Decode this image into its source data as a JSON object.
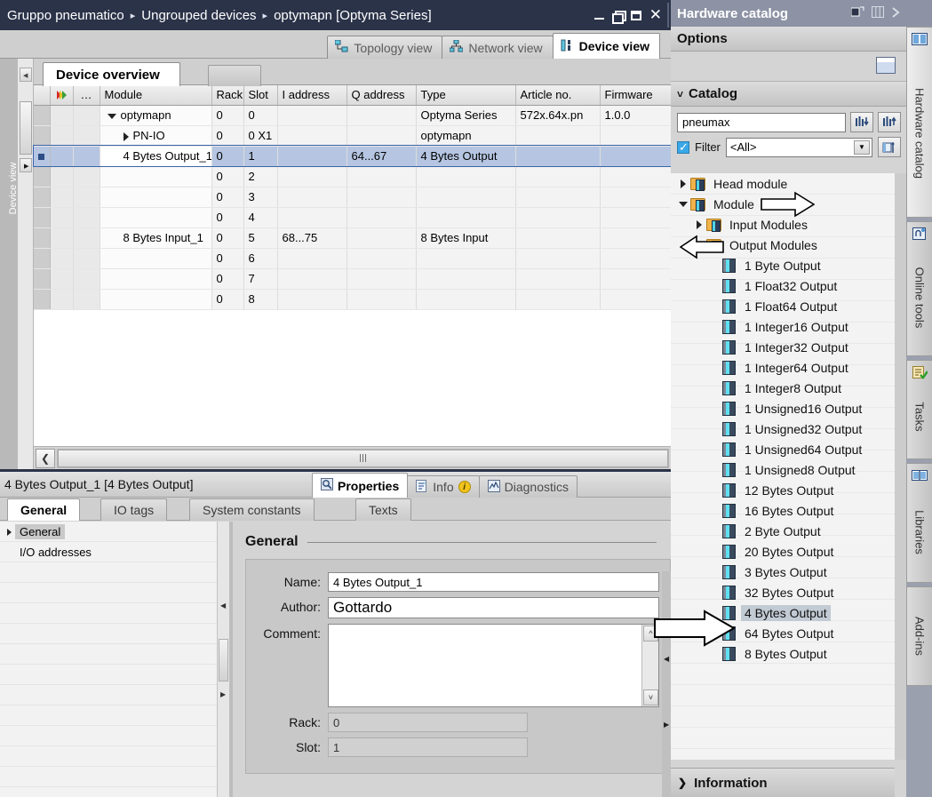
{
  "titlebar": {
    "breadcrumb": [
      "Gruppo pneumatico",
      "Ungrouped devices",
      "optymapn [Optyma Series]"
    ],
    "separator": "▸",
    "buttons": {
      "minimize": "minimize-icon",
      "restore": "restore-icon",
      "maximize": "maximize-icon",
      "close": "✕"
    }
  },
  "view_tabs": [
    {
      "label": "Topology view",
      "active": false
    },
    {
      "label": "Network view",
      "active": false
    },
    {
      "label": "Device view",
      "active": true
    }
  ],
  "left_rail": {
    "label": "Device view"
  },
  "device_overview": {
    "tab_label": "Device overview",
    "columns": [
      "",
      "…",
      "Module",
      "Rack",
      "Slot",
      "I address",
      "Q address",
      "Type",
      "Article no.",
      "Firmware"
    ],
    "rows": [
      {
        "module": "optymapn",
        "indent": 1,
        "twisty": "down",
        "rack": "0",
        "slot": "0",
        "i_address": "",
        "q_address": "",
        "type": "Optyma Series",
        "article": "572x.64x.pn",
        "firmware": "1.0.0",
        "selected": false
      },
      {
        "module": "PN-IO",
        "indent": 2,
        "twisty": "right",
        "rack": "0",
        "slot": "0 X1",
        "i_address": "",
        "q_address": "",
        "type": "optymapn",
        "article": "",
        "firmware": "",
        "selected": false
      },
      {
        "module": "4 Bytes Output_1",
        "indent": 2,
        "twisty": "none",
        "rack": "0",
        "slot": "1",
        "i_address": "",
        "q_address": "64...67",
        "type": "4 Bytes Output",
        "article": "",
        "firmware": "",
        "selected": true
      },
      {
        "module": "",
        "indent": 0,
        "twisty": "none",
        "rack": "0",
        "slot": "2",
        "i_address": "",
        "q_address": "",
        "type": "",
        "article": "",
        "firmware": "",
        "selected": false
      },
      {
        "module": "",
        "indent": 0,
        "twisty": "none",
        "rack": "0",
        "slot": "3",
        "i_address": "",
        "q_address": "",
        "type": "",
        "article": "",
        "firmware": "",
        "selected": false
      },
      {
        "module": "",
        "indent": 0,
        "twisty": "none",
        "rack": "0",
        "slot": "4",
        "i_address": "",
        "q_address": "",
        "type": "",
        "article": "",
        "firmware": "",
        "selected": false
      },
      {
        "module": "8 Bytes Input_1",
        "indent": 2,
        "twisty": "none",
        "rack": "0",
        "slot": "5",
        "i_address": "68...75",
        "q_address": "",
        "type": "8 Bytes Input",
        "article": "",
        "firmware": "",
        "selected": false
      },
      {
        "module": "",
        "indent": 0,
        "twisty": "none",
        "rack": "0",
        "slot": "6",
        "i_address": "",
        "q_address": "",
        "type": "",
        "article": "",
        "firmware": "",
        "selected": false
      },
      {
        "module": "",
        "indent": 0,
        "twisty": "none",
        "rack": "0",
        "slot": "7",
        "i_address": "",
        "q_address": "",
        "type": "",
        "article": "",
        "firmware": "",
        "selected": false
      },
      {
        "module": "",
        "indent": 0,
        "twisty": "none",
        "rack": "0",
        "slot": "8",
        "i_address": "",
        "q_address": "",
        "type": "",
        "article": "",
        "firmware": "",
        "selected": false
      }
    ]
  },
  "properties": {
    "header_title": "4 Bytes Output_1 [4 Bytes Output]",
    "tabs": [
      {
        "label": "Properties",
        "active": true,
        "icon": "properties-icon"
      },
      {
        "label": "Info",
        "active": false,
        "icon": "info-icon",
        "badge": "i"
      },
      {
        "label": "Diagnostics",
        "active": false,
        "icon": "diagnostics-icon"
      }
    ],
    "sub_tabs": [
      {
        "label": "General",
        "active": true
      },
      {
        "label": "IO tags",
        "active": false
      },
      {
        "label": "System constants",
        "active": false
      },
      {
        "label": "Texts",
        "active": false
      }
    ],
    "nav_items": [
      {
        "label": "General",
        "active": true,
        "twisty": "right"
      },
      {
        "label": "I/O addresses",
        "active": false,
        "twisty": "none"
      }
    ],
    "form": {
      "section_title": "General",
      "fields": [
        {
          "label": "Name:",
          "value": "4 Bytes Output_1",
          "readonly": false,
          "kind": "text"
        },
        {
          "label": "Author:",
          "value": "Gottardo",
          "readonly": false,
          "kind": "text-large"
        },
        {
          "label": "Comment:",
          "value": "",
          "readonly": false,
          "kind": "textarea"
        },
        {
          "label": "Rack:",
          "value": "0",
          "readonly": true,
          "kind": "text"
        },
        {
          "label": "Slot:",
          "value": "1",
          "readonly": true,
          "kind": "text"
        }
      ]
    }
  },
  "hardware_catalog": {
    "title": "Hardware catalog",
    "options_label": "Options",
    "catalog_label": "Catalog",
    "search_value": "pneumax",
    "search_placeholder": "",
    "filter_label": "Filter",
    "filter_value": "<All>",
    "information_label": "Information",
    "tree": [
      {
        "label": "Head module",
        "depth": 0,
        "twisty": "right",
        "icon": "folder-module-icon",
        "selected": false
      },
      {
        "label": "Module",
        "depth": 0,
        "twisty": "down",
        "icon": "folder-module-icon",
        "selected": false,
        "annotated": true
      },
      {
        "label": "Input Modules",
        "depth": 1,
        "twisty": "right",
        "icon": "folder-module-icon",
        "selected": false
      },
      {
        "label": "Output Modules",
        "depth": 1,
        "twisty": "down",
        "icon": "folder-module-icon",
        "selected": false,
        "annotated": true
      },
      {
        "label": "1 Byte Output",
        "depth": 2,
        "twisty": "none",
        "icon": "module-icon",
        "selected": false
      },
      {
        "label": "1 Float32 Output",
        "depth": 2,
        "twisty": "none",
        "icon": "module-icon",
        "selected": false
      },
      {
        "label": "1 Float64 Output",
        "depth": 2,
        "twisty": "none",
        "icon": "module-icon",
        "selected": false
      },
      {
        "label": "1 Integer16 Output",
        "depth": 2,
        "twisty": "none",
        "icon": "module-icon",
        "selected": false
      },
      {
        "label": "1 Integer32 Output",
        "depth": 2,
        "twisty": "none",
        "icon": "module-icon",
        "selected": false
      },
      {
        "label": "1 Integer64 Output",
        "depth": 2,
        "twisty": "none",
        "icon": "module-icon",
        "selected": false
      },
      {
        "label": "1 Integer8 Output",
        "depth": 2,
        "twisty": "none",
        "icon": "module-icon",
        "selected": false
      },
      {
        "label": "1 Unsigned16 Output",
        "depth": 2,
        "twisty": "none",
        "icon": "module-icon",
        "selected": false
      },
      {
        "label": "1 Unsigned32 Output",
        "depth": 2,
        "twisty": "none",
        "icon": "module-icon",
        "selected": false
      },
      {
        "label": "1 Unsigned64 Output",
        "depth": 2,
        "twisty": "none",
        "icon": "module-icon",
        "selected": false
      },
      {
        "label": "1 Unsigned8 Output",
        "depth": 2,
        "twisty": "none",
        "icon": "module-icon",
        "selected": false
      },
      {
        "label": "12 Bytes Output",
        "depth": 2,
        "twisty": "none",
        "icon": "module-icon",
        "selected": false
      },
      {
        "label": "16 Bytes Output",
        "depth": 2,
        "twisty": "none",
        "icon": "module-icon",
        "selected": false
      },
      {
        "label": "2 Byte Output",
        "depth": 2,
        "twisty": "none",
        "icon": "module-icon",
        "selected": false
      },
      {
        "label": "20 Bytes Output",
        "depth": 2,
        "twisty": "none",
        "icon": "module-icon",
        "selected": false
      },
      {
        "label": "3 Bytes Output",
        "depth": 2,
        "twisty": "none",
        "icon": "module-icon",
        "selected": false
      },
      {
        "label": "32 Bytes Output",
        "depth": 2,
        "twisty": "none",
        "icon": "module-icon",
        "selected": false
      },
      {
        "label": "4 Bytes Output",
        "depth": 2,
        "twisty": "none",
        "icon": "module-icon",
        "selected": true,
        "annotated": true
      },
      {
        "label": "64 Bytes Output",
        "depth": 2,
        "twisty": "none",
        "icon": "module-icon",
        "selected": false
      },
      {
        "label": "8 Bytes Output",
        "depth": 2,
        "twisty": "none",
        "icon": "module-icon",
        "selected": false
      }
    ]
  },
  "task_cards": [
    {
      "label": "Hardware catalog",
      "icon": "catalog-icon",
      "selected": true
    },
    {
      "label": "Online tools",
      "icon": "online-tools-icon",
      "selected": false
    },
    {
      "label": "Tasks",
      "icon": "tasks-icon",
      "selected": false
    },
    {
      "label": "Libraries",
      "icon": "libraries-icon",
      "selected": false
    },
    {
      "label": "Add-ins",
      "icon": "addins-icon",
      "selected": false
    }
  ],
  "colors": {
    "titlebar_bg": "#2b3349",
    "selection_blue": "#b6c6e2",
    "accent": "#3aa8e8",
    "panel_bg": "#d4d4d4"
  }
}
